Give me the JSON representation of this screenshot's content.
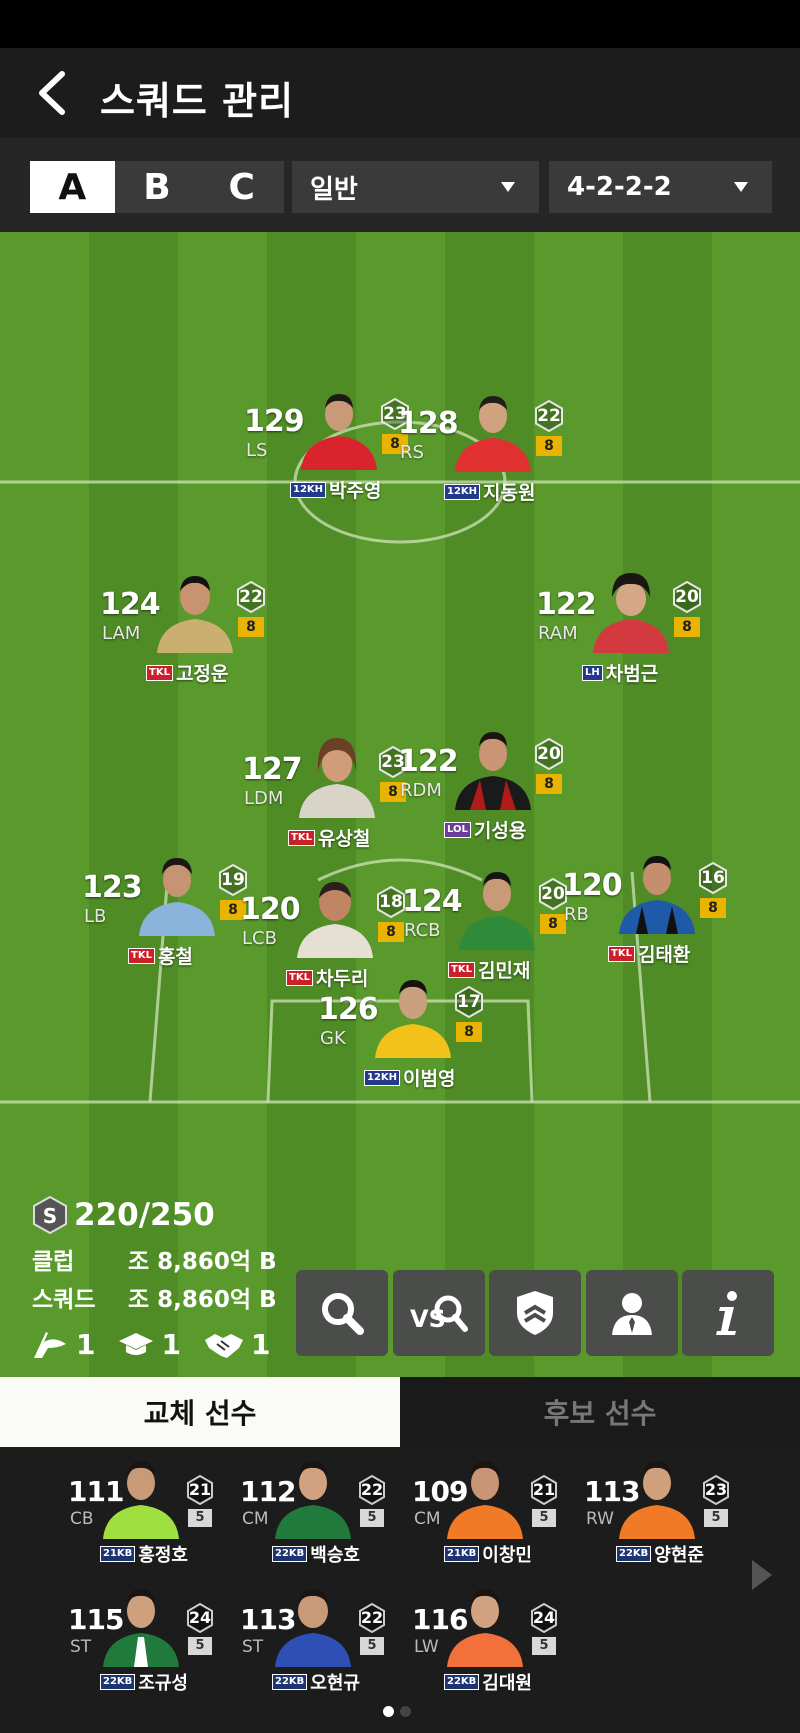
{
  "header": {
    "title": "스쿼드 관리"
  },
  "squad_tabs": [
    "A",
    "B",
    "C"
  ],
  "active_squad": "A",
  "mode_dropdown": "일반",
  "formation_dropdown": "4-2-2-2",
  "pitch_players": [
    {
      "ovr": "129",
      "pos": "LS",
      "chem": "23",
      "level": "8",
      "badge": "12KH",
      "name": "박주영",
      "kit": "#d9232d"
    },
    {
      "ovr": "128",
      "pos": "RS",
      "chem": "22",
      "level": "8",
      "badge": "12KH",
      "name": "지동원",
      "kit": "#e03030"
    },
    {
      "ovr": "124",
      "pos": "LAM",
      "chem": "22",
      "level": "8",
      "badge": "TKL",
      "name": "고정운",
      "kit": "#c9b070"
    },
    {
      "ovr": "122",
      "pos": "RAM",
      "chem": "20",
      "level": "8",
      "badge": "LH",
      "name": "차범근",
      "kit": "#d23a40"
    },
    {
      "ovr": "127",
      "pos": "LDM",
      "chem": "23",
      "level": "8",
      "badge": "TKL",
      "name": "유상철",
      "kit": "#d9d4c8"
    },
    {
      "ovr": "122",
      "pos": "RDM",
      "chem": "20",
      "level": "8",
      "badge": "LOL",
      "name": "기성용",
      "kit": "#b01c1c"
    },
    {
      "ovr": "123",
      "pos": "LB",
      "chem": "19",
      "level": "8",
      "badge": "TKL",
      "name": "홍철",
      "kit": "#8ab4dc"
    },
    {
      "ovr": "120",
      "pos": "LCB",
      "chem": "18",
      "level": "8",
      "badge": "TKL",
      "name": "차두리",
      "kit": "#e6e0d4"
    },
    {
      "ovr": "124",
      "pos": "RCB",
      "chem": "20",
      "level": "8",
      "badge": "TKL",
      "name": "김민재",
      "kit": "#2f8a3a"
    },
    {
      "ovr": "120",
      "pos": "RB",
      "chem": "16",
      "level": "8",
      "badge": "TKL",
      "name": "김태환",
      "kit": "#1e5aa8"
    },
    {
      "ovr": "126",
      "pos": "GK",
      "chem": "17",
      "level": "8",
      "badge": "12KH",
      "name": "이범영",
      "kit": "#f2c21a"
    }
  ],
  "club_stats": {
    "salary": "220/250",
    "club_label": "클럽",
    "club_value": "조 8,860억 BP",
    "squad_label": "스쿼드",
    "squad_value": "조 8,860억 BP",
    "flag_count": "1",
    "cap_count": "1",
    "handshake_count": "1"
  },
  "actions": [
    "search-icon",
    "vs-search-icon",
    "shield-icon",
    "person-icon",
    "info-icon"
  ],
  "bottom_tabs": [
    "교체 선수",
    "후보 선수"
  ],
  "subs": [
    {
      "ovr": "111",
      "pos": "CB",
      "chem": "21",
      "level": "5",
      "badge": "21KB",
      "name": "홍정호",
      "kit": "#9fe040"
    },
    {
      "ovr": "112",
      "pos": "CM",
      "chem": "22",
      "level": "5",
      "badge": "22KB",
      "name": "백승호",
      "kit": "#1f7a3c"
    },
    {
      "ovr": "109",
      "pos": "CM",
      "chem": "21",
      "level": "5",
      "badge": "21KB",
      "name": "이창민",
      "kit": "#f07a26"
    },
    {
      "ovr": "113",
      "pos": "RW",
      "chem": "23",
      "level": "5",
      "badge": "22KB",
      "name": "양현준",
      "kit": "#f07a26"
    },
    {
      "ovr": "115",
      "pos": "ST",
      "chem": "24",
      "level": "5",
      "badge": "22KB",
      "name": "조규성",
      "kit": "#1f7a3c"
    },
    {
      "ovr": "113",
      "pos": "ST",
      "chem": "22",
      "level": "5",
      "badge": "22KB",
      "name": "오현규",
      "kit": "#2e4fb5"
    },
    {
      "ovr": "116",
      "pos": "LW",
      "chem": "24",
      "level": "5",
      "badge": "22KB",
      "name": "김대원",
      "kit": "#f2703a"
    }
  ],
  "pager": {
    "pages": 2,
    "current": 1
  }
}
